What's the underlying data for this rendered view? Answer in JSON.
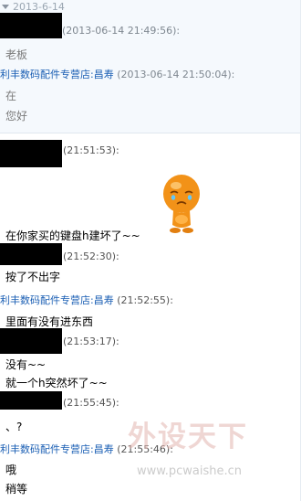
{
  "date_header": "2013-6-14",
  "messages": [
    {
      "sender": "",
      "time": "(2013-06-14 21:49:56):",
      "text": "老板",
      "old": true
    },
    {
      "sender": "利丰数码配件专营店:昌寿",
      "time": "(2013-06-14 21:50:04):",
      "lines": [
        "在",
        "您好"
      ],
      "old": true
    },
    {
      "sender": "",
      "time": "(21:51:53):",
      "text": "在你家买的键盘h建坏了~~"
    },
    {
      "sender": "",
      "time": "(21:52:30):",
      "text": "按了不出字"
    },
    {
      "sender": "利丰数码配件专营店:昌寿",
      "time": "(21:52:55):",
      "text": "里面有没有进东西"
    },
    {
      "sender": "",
      "time": "(21:53:17):",
      "lines": [
        "没有~~",
        "就一个h突然坏了~~"
      ]
    },
    {
      "sender": "",
      "time": "(21:55:45):",
      "text": "、?"
    },
    {
      "sender": "利丰数码配件专营店:昌寿",
      "time": "(21:55:46):",
      "lines": [
        "哦",
        "稍等"
      ]
    }
  ],
  "watermark": {
    "title": "外设天下",
    "url": "www.pcwaishe.cn"
  },
  "colors": {
    "shop_blue": "#1b5fb4",
    "top_bg": "#f5f9fd",
    "emoji_orange": "#f29218"
  },
  "emoji_icon": "sad-pleading-mascot-icon"
}
